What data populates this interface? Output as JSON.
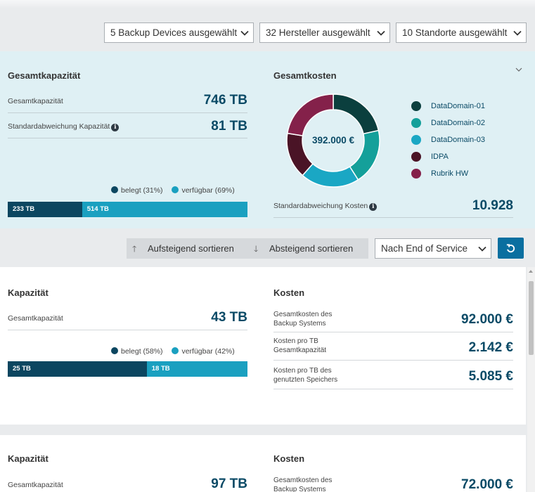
{
  "filters": [
    {
      "label": "5 Backup Devices ausgewählt"
    },
    {
      "label": "32 Hersteller ausgewählt"
    },
    {
      "label": "10 Standorte ausgewählt"
    }
  ],
  "summary": {
    "capacity": {
      "title": "Gesamtkapazität",
      "total_label": "Gesamtkapazität",
      "total_value": "746 TB",
      "stddev_label": "Standardabweichung Kapazität",
      "stddev_value": "81 TB",
      "legend_used": "belegt (31%)",
      "legend_free": "verfügbar (69%)",
      "used_fraction": 0.31,
      "bar_used_label": "233 TB",
      "bar_free_label": "514 TB"
    },
    "costs": {
      "title": "Gesamtkosten",
      "donut_center": "392.000 €",
      "donut_segments": [
        {
          "name": "DataDomain-01",
          "fraction": 0.215,
          "color": "#0b3f3e"
        },
        {
          "name": "DataDomain-02",
          "fraction": 0.195,
          "color": "#14a09a"
        },
        {
          "name": "DataDomain-03",
          "fraction": 0.205,
          "color": "#1aa7c4"
        },
        {
          "name": "IDPA",
          "fraction": 0.16,
          "color": "#4a1426"
        },
        {
          "name": "Rubrik HW",
          "fraction": 0.225,
          "color": "#84214a"
        }
      ],
      "stddev_label": "Standardabweichung Kosten",
      "stddev_value": "10.928"
    },
    "collapse_icon": "chevron-down-icon"
  },
  "sort": {
    "ascending": "Aufsteigend sortieren",
    "descending": "Absteigend sortieren",
    "sort_by": "Nach End of Service",
    "reset_icon": "reset-icon"
  },
  "cards": [
    {
      "capacity_title": "Kapazität",
      "total_label": "Gesamtkapazität",
      "total_value": "43 TB",
      "legend_used": "belegt (58%)",
      "legend_free": "verfügbar (42%)",
      "used_fraction": 0.58,
      "bar_used_label": "25 TB",
      "bar_free_label": "18 TB",
      "costs_title": "Kosten",
      "cost_rows": [
        {
          "label": "Gesamtkosten des Backup Systems",
          "value": "92.000 €"
        },
        {
          "label": "Kosten pro TB Gesamtkapazität",
          "value": "2.142 €"
        },
        {
          "label": "Kosten pro TB des genutzten Speichers",
          "value": "5.085 €"
        }
      ]
    },
    {
      "capacity_title": "Kapazität",
      "total_label": "Gesamtkapazität",
      "total_value": "97 TB",
      "costs_title": "Kosten",
      "cost_rows": [
        {
          "label": "Gesamtkosten des Backup Systems",
          "value": "72.000 €"
        }
      ]
    }
  ],
  "colors": {
    "used": "#0c4660",
    "free": "#1aa0c0",
    "accent": "#0a6fa0",
    "value_text": "#0a4a66"
  }
}
